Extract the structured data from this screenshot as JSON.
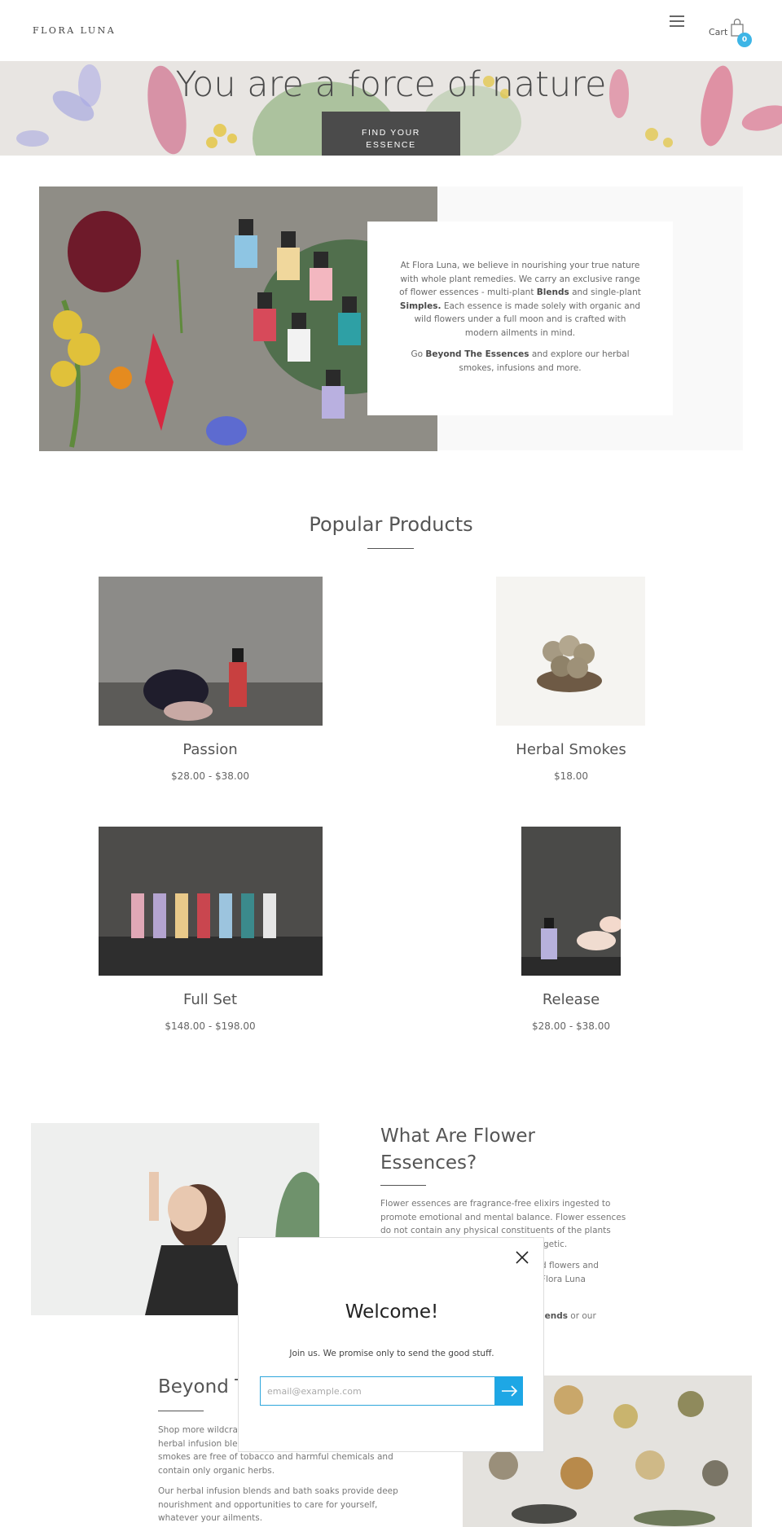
{
  "header": {
    "logo": "FLORA LUNA",
    "cart_label": "Cart",
    "cart_count": "0"
  },
  "hero": {
    "title": "You are a force of nature",
    "button_line1": "FIND YOUR",
    "button_line2": "ESSENCE"
  },
  "about": {
    "p1_a": "At Flora Luna, we believe in nourishing your true nature with whole plant remedies. We carry an exclusive range of flower essences - multi-plant ",
    "p1_blends": "Blends",
    "p1_b": " and single-plant ",
    "p1_simples": "Simples.",
    "p1_c": " Each essence is made solely with organic and wild flowers under a full moon and is crafted with modern ailments in mind.",
    "p2_a": "Go ",
    "p2_link": "Beyond The Essences",
    "p2_b": " and explore our herbal smokes, infusions and more."
  },
  "popular": {
    "title": "Popular Products",
    "products": [
      {
        "name": "Passion",
        "price": "$28.00 - $38.00"
      },
      {
        "name": "Herbal Smokes",
        "price": "$18.00"
      },
      {
        "name": "Full Set",
        "price": "$148.00 - $198.00"
      },
      {
        "name": "Release",
        "price": "$28.00 - $38.00"
      }
    ]
  },
  "essences": {
    "title_line1": "What Are Flower",
    "title_line2": "Essences?",
    "p1": "Flower essences are fragrance-free elixirs ingested to promote emotional and mental balance. Flower essences do not contain any physical constituents of the plants that",
    "p1_end": "getic.",
    "p2_line1": "d flowers and",
    "p2_line2": "Flora Luna",
    "p3_bold": "lends",
    "p3_end": " or our"
  },
  "beyond": {
    "title": "Beyond T",
    "p1_line1": "Shop more wildcraf",
    "p1_line2": "herbal infusion blen",
    "p1_line3": "smokes are free of tobacco and harmful chemicals and",
    "p1_line4": "contain only organic herbs.",
    "p2": "Our herbal infusion blends and bath soaks provide deep nourishment and opportunities to care for yourself, whatever your ailments."
  },
  "modal": {
    "title": "Welcome!",
    "subtitle": "Join us. We promise only to send the good stuff.",
    "email_placeholder": "email@example.com"
  },
  "colors": {
    "accent": "#1ea7e5",
    "cart_badge": "#3db5e6",
    "hero_button": "#4b4b4b"
  }
}
